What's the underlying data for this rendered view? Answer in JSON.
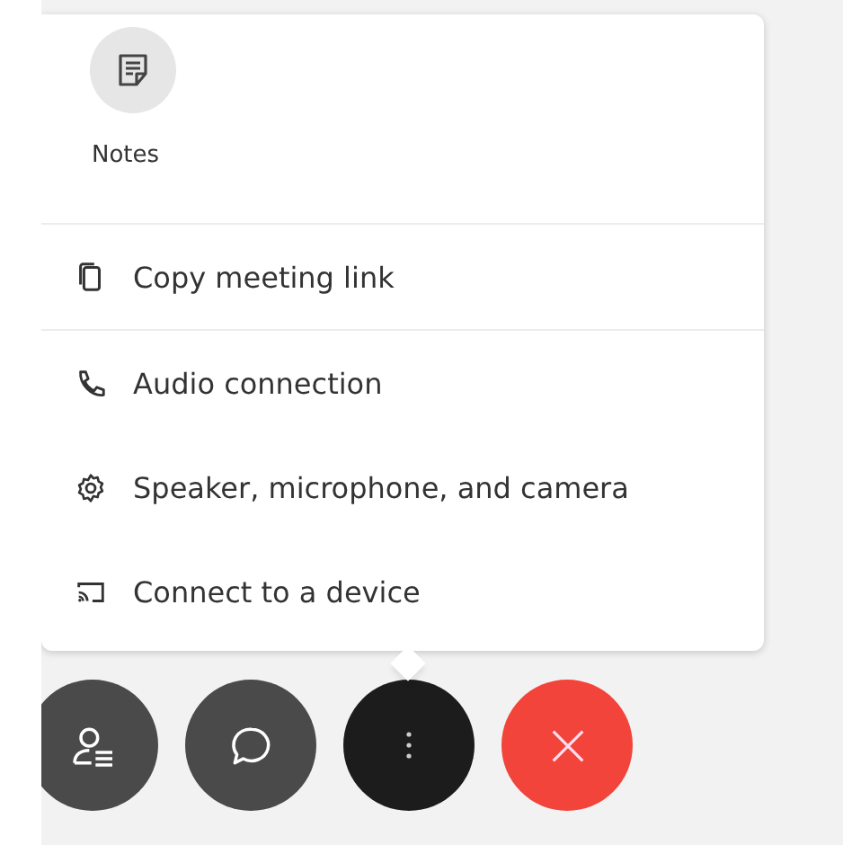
{
  "notes_button": {
    "label": "Notes"
  },
  "menu_sections": [
    [
      {
        "kind": "copy",
        "label": "Copy meeting link"
      }
    ],
    [
      {
        "kind": "phone",
        "label": "Audio connection"
      },
      {
        "kind": "gear",
        "label": "Speaker, microphone, and camera"
      },
      {
        "kind": "cast",
        "label": "Connect to a device"
      }
    ]
  ],
  "call_controls": [
    {
      "kind": "participants",
      "selected": false
    },
    {
      "kind": "chat",
      "selected": false
    },
    {
      "kind": "more",
      "selected": true
    },
    {
      "kind": "leave",
      "selected": false
    }
  ]
}
